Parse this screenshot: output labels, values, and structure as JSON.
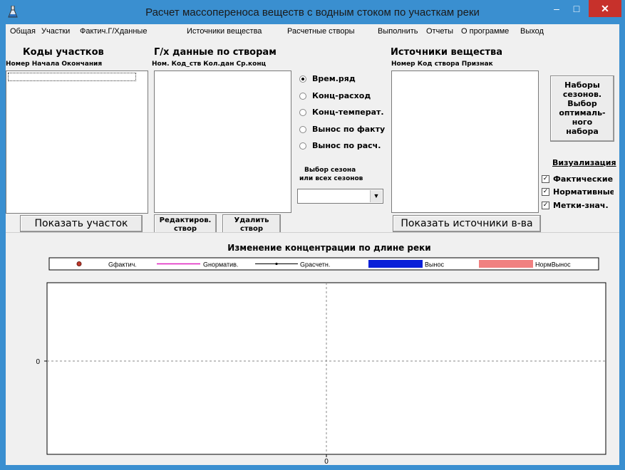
{
  "window": {
    "title": "Расчет массопереноса веществ с водным стоком  по участкам реки",
    "min_glyph": "–",
    "max_glyph": "□",
    "close_glyph": "✕"
  },
  "menu": [
    "Общая",
    "Участки",
    "Фактич.Г/Хданные",
    "Источники вещества",
    "Расчетные створы",
    "Выполнить",
    "Отчеты",
    "О программе",
    "Выход"
  ],
  "sections": {
    "segments": {
      "title": "Коды участков",
      "columns": "Номер Начала   Окончания",
      "button": "Показать участок"
    },
    "hydro": {
      "title": "Г/х данные по створам",
      "columns": "Ном.  Код_ств Кол.дан Ср.конц",
      "edit_button_line1": "Редактиров.",
      "edit_button_line2": "створ",
      "delete_button_line1": "Удалить",
      "delete_button_line2": "створ"
    },
    "sources": {
      "title": "Источники вещества",
      "columns": "Номер  Код створа  Признак",
      "button": "Показать источники в-ва"
    }
  },
  "radios": [
    {
      "label": "Врем.ряд",
      "selected": true
    },
    {
      "label": "Конц-расход",
      "selected": false
    },
    {
      "label": "Конц-температ.",
      "selected": false
    },
    {
      "label": "Вынос по факту",
      "selected": false
    },
    {
      "label": "Вынос по расч.",
      "selected": false
    }
  ],
  "season": {
    "label_line1": "Выбор сезона",
    "label_line2": "или всех сезонов",
    "value": "",
    "arrow": "▼"
  },
  "sets_button": {
    "lines": [
      "Наборы",
      "сезонов.",
      "Выбор",
      "оптималь-",
      "ного",
      "набора"
    ]
  },
  "visualization": {
    "title": "Визуализация",
    "checks": [
      {
        "label": "Фактические",
        "checked": true
      },
      {
        "label": "Нормативные",
        "checked": true
      },
      {
        "label": "Метки-знач.",
        "checked": true
      }
    ],
    "check_glyph": "✓"
  },
  "chart_data": {
    "type": "line",
    "title": "Изменение концентрации по длине реки",
    "series": [
      {
        "name": "Gфактич.",
        "values": [],
        "color": "#c0392b"
      },
      {
        "name": "Gнорматив.",
        "values": [],
        "color": "#e020c0"
      },
      {
        "name": "Gрасчетн.",
        "values": [],
        "color": "#000000"
      },
      {
        "name": "Вынос",
        "values": [],
        "color": "#0a1fd8"
      },
      {
        "name": "НормВынос",
        "values": [],
        "color": "#f08080"
      }
    ],
    "x_tick_labels": [
      "0"
    ],
    "y_tick_labels": [
      "0"
    ],
    "grid": "dashed center lines",
    "legend_position": "top"
  }
}
